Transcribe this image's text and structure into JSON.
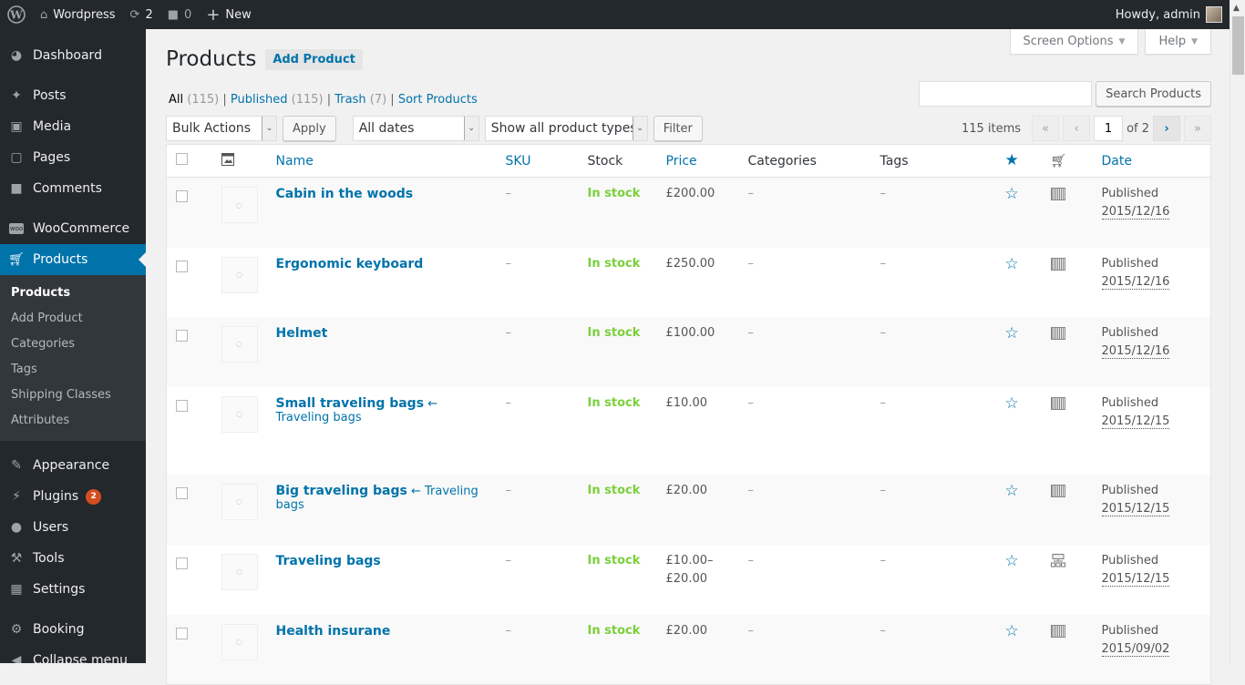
{
  "adminbar": {
    "site_name": "Wordpress",
    "updates_count": "2",
    "comments_count": "0",
    "new_label": "New",
    "howdy": "Howdy, admin"
  },
  "sidebar": {
    "items": [
      {
        "label": "Dashboard",
        "icon": "dashboard-icon"
      },
      {
        "label": "Posts",
        "icon": "pin-icon"
      },
      {
        "label": "Media",
        "icon": "media-icon"
      },
      {
        "label": "Pages",
        "icon": "pages-icon"
      },
      {
        "label": "Comments",
        "icon": "comment-icon"
      },
      {
        "label": "WooCommerce",
        "icon": "woo-icon"
      },
      {
        "label": "Products",
        "icon": "cart-icon"
      },
      {
        "label": "Appearance",
        "icon": "brush-icon"
      },
      {
        "label": "Plugins",
        "icon": "plugin-icon",
        "badge": "2"
      },
      {
        "label": "Users",
        "icon": "user-icon"
      },
      {
        "label": "Tools",
        "icon": "wrench-icon"
      },
      {
        "label": "Settings",
        "icon": "settings-icon"
      },
      {
        "label": "Booking",
        "icon": "gear-icon"
      },
      {
        "label": "Collapse menu",
        "icon": "collapse-icon"
      }
    ],
    "submenu": [
      "Products",
      "Add Product",
      "Categories",
      "Tags",
      "Shipping Classes",
      "Attributes"
    ]
  },
  "screen_meta": {
    "screen_options": "Screen Options",
    "help": "Help"
  },
  "page": {
    "title": "Products",
    "add_new": "Add Product"
  },
  "views": {
    "all": "All",
    "all_count": "(115)",
    "published": "Published",
    "published_count": "(115)",
    "trash": "Trash",
    "trash_count": "(7)",
    "sort": "Sort Products"
  },
  "search": {
    "value": "",
    "button": "Search Products"
  },
  "tablenav": {
    "bulk_actions": "Bulk Actions",
    "apply": "Apply",
    "dates": "All dates",
    "product_types": "Show all product types",
    "filter": "Filter",
    "items": "115 items",
    "first": "«",
    "prev": "‹",
    "current_page": "1",
    "of_pages": "of 2",
    "next": "›",
    "last": "»"
  },
  "table": {
    "columns": {
      "name": "Name",
      "sku": "SKU",
      "stock": "Stock",
      "price": "Price",
      "categories": "Categories",
      "tags": "Tags",
      "date": "Date"
    },
    "rows": [
      {
        "name": "Cabin in the woods",
        "parent": "",
        "sku": "–",
        "stock": "In stock",
        "price": "£200.00",
        "categories": "–",
        "tags": "–",
        "type": "simple",
        "status": "Published",
        "date": "2015/12/16"
      },
      {
        "name": "Ergonomic keyboard",
        "parent": "",
        "sku": "–",
        "stock": "In stock",
        "price": "£250.00",
        "categories": "–",
        "tags": "–",
        "type": "simple",
        "status": "Published",
        "date": "2015/12/16"
      },
      {
        "name": "Helmet",
        "parent": "",
        "sku": "–",
        "stock": "In stock",
        "price": "£100.00",
        "categories": "–",
        "tags": "–",
        "type": "simple",
        "status": "Published",
        "date": "2015/12/16"
      },
      {
        "name": "Small traveling bags",
        "parent": "← Traveling bags",
        "sku": "–",
        "stock": "In stock",
        "price": "£10.00",
        "categories": "–",
        "tags": "–",
        "type": "simple",
        "status": "Published",
        "date": "2015/12/15"
      },
      {
        "name": "Big traveling bags",
        "parent": "← Traveling bags",
        "sku": "–",
        "stock": "In stock",
        "price": "£20.00",
        "categories": "–",
        "tags": "–",
        "type": "simple",
        "status": "Published",
        "date": "2015/12/15"
      },
      {
        "name": "Traveling bags",
        "parent": "",
        "sku": "–",
        "stock": "In stock",
        "price": "£10.00–£20.00",
        "categories": "–",
        "tags": "–",
        "type": "grouped",
        "status": "Published",
        "date": "2015/12/15"
      },
      {
        "name": "Health insurane",
        "parent": "",
        "sku": "–",
        "stock": "In stock",
        "price": "£20.00",
        "categories": "–",
        "tags": "–",
        "type": "simple",
        "status": "Published",
        "date": "2015/09/02"
      }
    ]
  }
}
